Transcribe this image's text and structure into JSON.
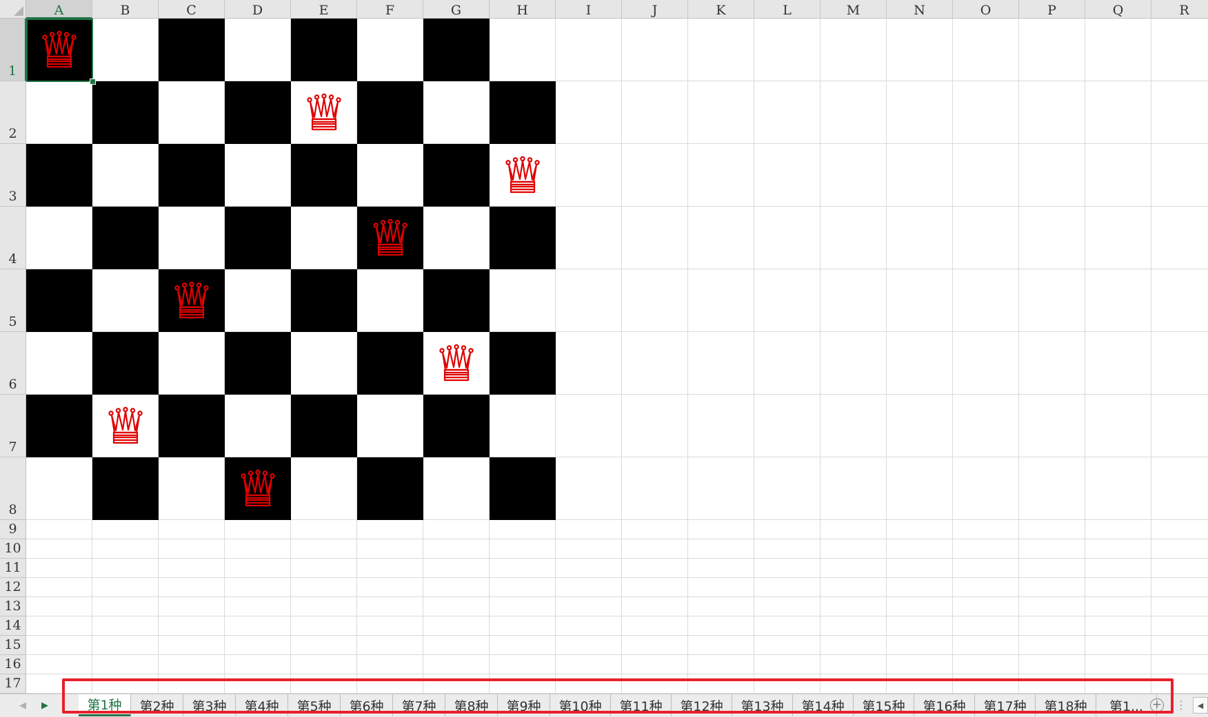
{
  "spreadsheet": {
    "columns": [
      "A",
      "B",
      "C",
      "D",
      "E",
      "F",
      "G",
      "H",
      "I",
      "J",
      "K",
      "L",
      "M",
      "N",
      "O",
      "P",
      "Q",
      "R"
    ],
    "rows": [
      "1",
      "2",
      "3",
      "4",
      "5",
      "6",
      "7",
      "8",
      "9",
      "10",
      "11",
      "12",
      "13",
      "14",
      "15",
      "16",
      "17"
    ],
    "active_cell": "A1",
    "board_colors": {
      "dark": "#000000",
      "light": "#ffffff"
    },
    "queen_icon": "queen-crown-icon",
    "queen_color": "#e00000",
    "queen_positions": [
      {
        "row": 1,
        "col": "A"
      },
      {
        "row": 2,
        "col": "E"
      },
      {
        "row": 3,
        "col": "H"
      },
      {
        "row": 4,
        "col": "F"
      },
      {
        "row": 5,
        "col": "C"
      },
      {
        "row": 6,
        "col": "G"
      },
      {
        "row": 7,
        "col": "B"
      },
      {
        "row": 8,
        "col": "D"
      }
    ]
  },
  "sheet_tabs": {
    "active_index": 0,
    "tabs": [
      "第1种",
      "第2种",
      "第3种",
      "第4种",
      "第5种",
      "第6种",
      "第7种",
      "第8种",
      "第9种",
      "第10种",
      "第11种",
      "第12种",
      "第13种",
      "第14种",
      "第15种",
      "第16种",
      "第17种",
      "第18种",
      "第1..."
    ],
    "add_sheet_label": "+",
    "prev_icon": "triangle-left-icon",
    "next_icon": "triangle-right-icon"
  },
  "annotation": {
    "highlight_color": "#e8202a"
  }
}
